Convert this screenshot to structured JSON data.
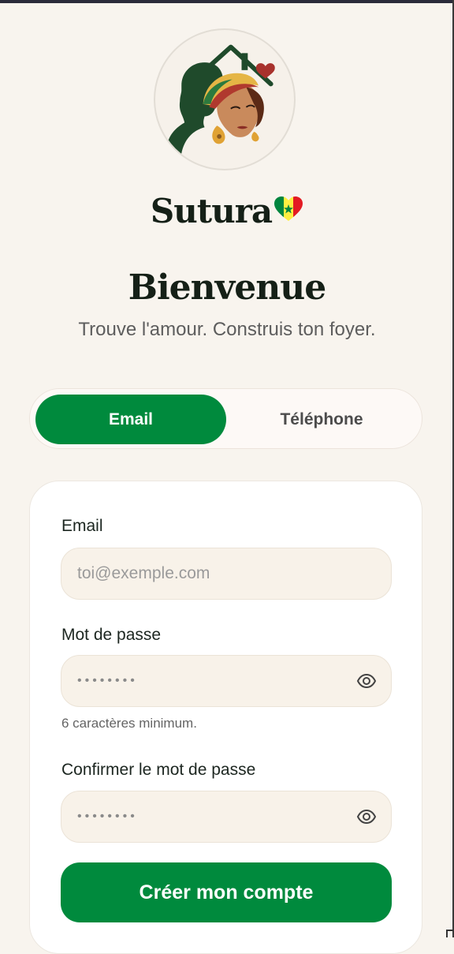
{
  "brand": {
    "name": "Sutura",
    "heart_icon": "senegal-flag-heart-icon"
  },
  "logo": {
    "icon": "couple-house-logo-icon"
  },
  "welcome": {
    "title": "Bienvenue",
    "tagline": "Trouve l'amour. Construis ton foyer."
  },
  "tabs": [
    {
      "label": "Email",
      "active": true
    },
    {
      "label": "Téléphone",
      "active": false
    }
  ],
  "form": {
    "email": {
      "label": "Email",
      "placeholder": "toi@exemple.com",
      "value": ""
    },
    "password": {
      "label": "Mot de passe",
      "masked_value": "••••••••",
      "hint": "6 caractères minimum.",
      "toggle_icon": "eye-icon"
    },
    "confirm": {
      "label": "Confirmer le mot de passe",
      "masked_value": "••••••••",
      "toggle_icon": "eye-icon"
    },
    "submit_label": "Créer mon compte"
  },
  "colors": {
    "primary": "#008a3d",
    "background": "#f8f4ee",
    "text": "#152017",
    "field_bg": "#f8f2e9"
  }
}
